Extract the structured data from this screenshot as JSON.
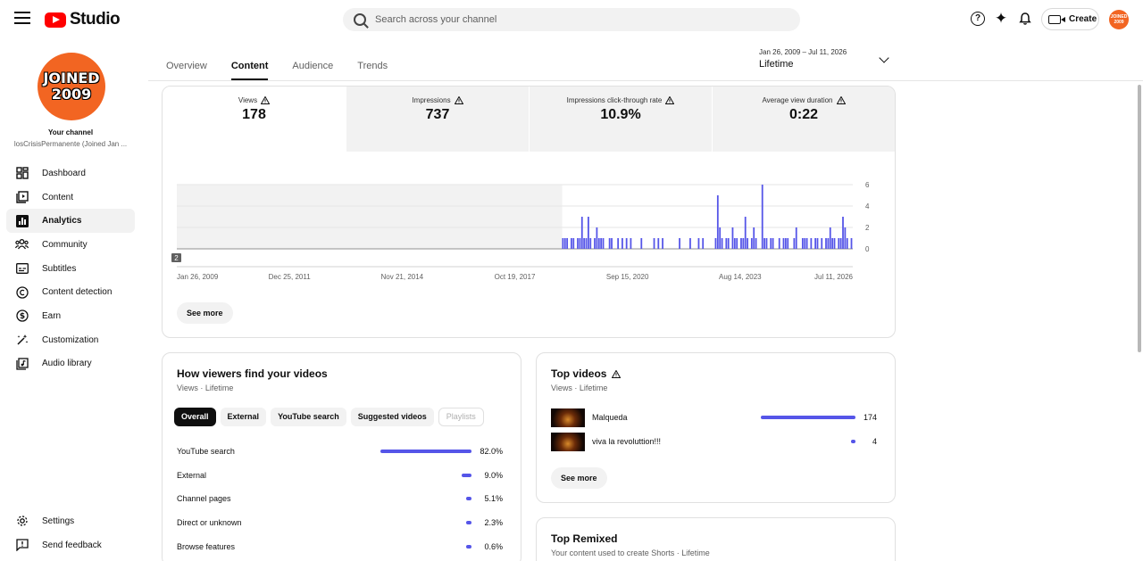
{
  "app": {
    "logo_text": "Studio",
    "search_placeholder": "Search across your channel",
    "create_label": "Create",
    "avatar_text": "JOINED 2009"
  },
  "sidebar": {
    "avatar_text_line1": "JOINED",
    "avatar_text_line2": "2009",
    "your_channel": "Your channel",
    "channel_name": "losCrisisPermanente (Joined Jan ...",
    "items": [
      {
        "label": "Dashboard",
        "icon": "dashboard-icon"
      },
      {
        "label": "Content",
        "icon": "content-icon"
      },
      {
        "label": "Analytics",
        "icon": "analytics-icon",
        "active": true
      },
      {
        "label": "Community",
        "icon": "community-icon"
      },
      {
        "label": "Subtitles",
        "icon": "subtitles-icon"
      },
      {
        "label": "Content detection",
        "icon": "copyright-icon"
      },
      {
        "label": "Earn",
        "icon": "dollar-icon"
      },
      {
        "label": "Customization",
        "icon": "magic-wand-icon"
      },
      {
        "label": "Audio library",
        "icon": "audio-library-icon"
      }
    ],
    "bottom_items": [
      {
        "label": "Settings",
        "icon": "gear-icon"
      },
      {
        "label": "Send feedback",
        "icon": "feedback-icon"
      }
    ]
  },
  "tabs": [
    "Overview",
    "Content",
    "Audience",
    "Trends"
  ],
  "active_tab": "Content",
  "date_range": {
    "dates": "Jan 26, 2009 – Jul 11, 2026",
    "label": "Lifetime"
  },
  "metrics": [
    {
      "label": "Views",
      "value": "178"
    },
    {
      "label": "Impressions",
      "value": "737"
    },
    {
      "label": "Impressions click-through rate",
      "value": "10.9%"
    },
    {
      "label": "Average view duration",
      "value": "0:22"
    }
  ],
  "chart_data": {
    "type": "bar",
    "x_tick_labels": [
      "Jan 26, 2009",
      "Dec 25, 2011",
      "Nov 21, 2014",
      "Oct 19, 2017",
      "Sep 15, 2020",
      "Aug 14, 2023",
      "Jul 11, 2026"
    ],
    "y_tick_labels": [
      "6",
      "4",
      "2",
      "0"
    ],
    "ylim": [
      0,
      6
    ],
    "marker_badge": "2",
    "series_color": "#5555e8",
    "values_from_fraction": 0.57,
    "values": [
      1,
      1,
      1,
      0,
      1,
      1,
      0,
      1,
      1,
      3,
      1,
      1,
      3,
      1,
      0,
      1,
      2,
      1,
      1,
      1,
      0,
      0,
      1,
      1,
      0,
      0,
      1,
      0,
      1,
      0,
      1,
      0,
      1,
      0,
      0,
      0,
      0,
      1,
      0,
      0,
      0,
      0,
      0,
      1,
      0,
      1,
      0,
      1,
      0,
      0,
      0,
      0,
      0,
      0,
      0,
      1,
      0,
      0,
      0,
      0,
      1,
      0,
      0,
      0,
      1,
      0,
      1,
      0,
      0,
      0,
      0,
      0,
      1,
      5,
      2,
      1,
      0,
      1,
      1,
      0,
      2,
      1,
      1,
      0,
      1,
      1,
      3,
      1,
      0,
      1,
      2,
      1,
      0,
      0,
      6,
      1,
      1,
      0,
      1,
      1,
      0,
      0,
      1,
      0,
      1,
      1,
      1,
      0,
      0,
      1,
      2,
      0,
      0,
      1,
      1,
      1,
      0,
      1,
      0,
      1,
      1,
      0,
      1,
      0,
      1,
      1,
      2,
      1,
      1,
      0,
      1,
      1,
      3,
      2,
      1,
      0,
      1
    ]
  },
  "see_more": "See more",
  "traffic": {
    "title": "How viewers find your videos",
    "subtitle": "Views · Lifetime",
    "chips": [
      "Overall",
      "External",
      "YouTube search",
      "Suggested videos",
      "Playlists"
    ],
    "rows": [
      {
        "label": "YouTube search",
        "value": "82.0%",
        "fraction": 0.82
      },
      {
        "label": "External",
        "value": "9.0%",
        "fraction": 0.09
      },
      {
        "label": "Channel pages",
        "value": "5.1%",
        "fraction": 0.051
      },
      {
        "label": "Direct or unknown",
        "value": "2.3%",
        "fraction": 0.023
      },
      {
        "label": "Browse features",
        "value": "0.6%",
        "fraction": 0.006
      }
    ]
  },
  "top_videos": {
    "title": "Top videos",
    "subtitle": "Views · Lifetime",
    "rows": [
      {
        "title": "Malqueda",
        "value": "174",
        "views": 174
      },
      {
        "title": "viva la revoluttion!!!",
        "value": "4",
        "views": 4
      }
    ]
  },
  "top_remixed": {
    "title": "Top Remixed",
    "subtitle": "Your content used to create Shorts · Lifetime"
  }
}
